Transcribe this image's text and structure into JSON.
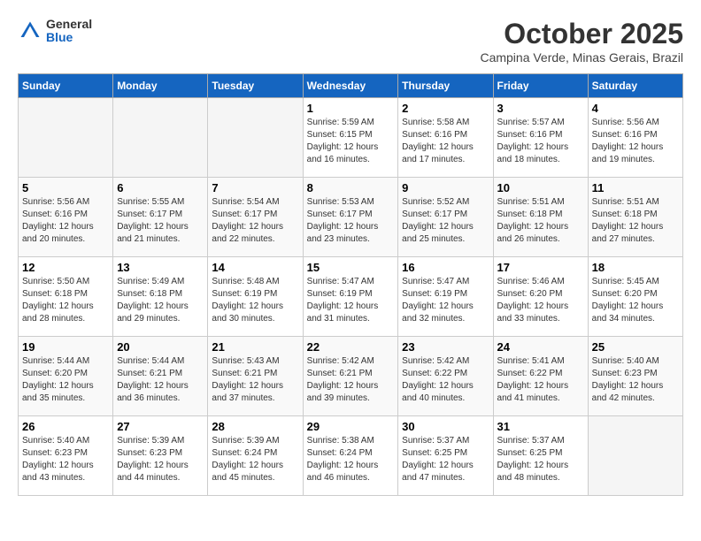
{
  "header": {
    "logo_general": "General",
    "logo_blue": "Blue",
    "month_title": "October 2025",
    "location": "Campina Verde, Minas Gerais, Brazil"
  },
  "weekdays": [
    "Sunday",
    "Monday",
    "Tuesday",
    "Wednesday",
    "Thursday",
    "Friday",
    "Saturday"
  ],
  "weeks": [
    [
      {
        "day": "",
        "info": ""
      },
      {
        "day": "",
        "info": ""
      },
      {
        "day": "",
        "info": ""
      },
      {
        "day": "1",
        "info": "Sunrise: 5:59 AM\nSunset: 6:15 PM\nDaylight: 12 hours\nand 16 minutes."
      },
      {
        "day": "2",
        "info": "Sunrise: 5:58 AM\nSunset: 6:16 PM\nDaylight: 12 hours\nand 17 minutes."
      },
      {
        "day": "3",
        "info": "Sunrise: 5:57 AM\nSunset: 6:16 PM\nDaylight: 12 hours\nand 18 minutes."
      },
      {
        "day": "4",
        "info": "Sunrise: 5:56 AM\nSunset: 6:16 PM\nDaylight: 12 hours\nand 19 minutes."
      }
    ],
    [
      {
        "day": "5",
        "info": "Sunrise: 5:56 AM\nSunset: 6:16 PM\nDaylight: 12 hours\nand 20 minutes."
      },
      {
        "day": "6",
        "info": "Sunrise: 5:55 AM\nSunset: 6:17 PM\nDaylight: 12 hours\nand 21 minutes."
      },
      {
        "day": "7",
        "info": "Sunrise: 5:54 AM\nSunset: 6:17 PM\nDaylight: 12 hours\nand 22 minutes."
      },
      {
        "day": "8",
        "info": "Sunrise: 5:53 AM\nSunset: 6:17 PM\nDaylight: 12 hours\nand 23 minutes."
      },
      {
        "day": "9",
        "info": "Sunrise: 5:52 AM\nSunset: 6:17 PM\nDaylight: 12 hours\nand 25 minutes."
      },
      {
        "day": "10",
        "info": "Sunrise: 5:51 AM\nSunset: 6:18 PM\nDaylight: 12 hours\nand 26 minutes."
      },
      {
        "day": "11",
        "info": "Sunrise: 5:51 AM\nSunset: 6:18 PM\nDaylight: 12 hours\nand 27 minutes."
      }
    ],
    [
      {
        "day": "12",
        "info": "Sunrise: 5:50 AM\nSunset: 6:18 PM\nDaylight: 12 hours\nand 28 minutes."
      },
      {
        "day": "13",
        "info": "Sunrise: 5:49 AM\nSunset: 6:18 PM\nDaylight: 12 hours\nand 29 minutes."
      },
      {
        "day": "14",
        "info": "Sunrise: 5:48 AM\nSunset: 6:19 PM\nDaylight: 12 hours\nand 30 minutes."
      },
      {
        "day": "15",
        "info": "Sunrise: 5:47 AM\nSunset: 6:19 PM\nDaylight: 12 hours\nand 31 minutes."
      },
      {
        "day": "16",
        "info": "Sunrise: 5:47 AM\nSunset: 6:19 PM\nDaylight: 12 hours\nand 32 minutes."
      },
      {
        "day": "17",
        "info": "Sunrise: 5:46 AM\nSunset: 6:20 PM\nDaylight: 12 hours\nand 33 minutes."
      },
      {
        "day": "18",
        "info": "Sunrise: 5:45 AM\nSunset: 6:20 PM\nDaylight: 12 hours\nand 34 minutes."
      }
    ],
    [
      {
        "day": "19",
        "info": "Sunrise: 5:44 AM\nSunset: 6:20 PM\nDaylight: 12 hours\nand 35 minutes."
      },
      {
        "day": "20",
        "info": "Sunrise: 5:44 AM\nSunset: 6:21 PM\nDaylight: 12 hours\nand 36 minutes."
      },
      {
        "day": "21",
        "info": "Sunrise: 5:43 AM\nSunset: 6:21 PM\nDaylight: 12 hours\nand 37 minutes."
      },
      {
        "day": "22",
        "info": "Sunrise: 5:42 AM\nSunset: 6:21 PM\nDaylight: 12 hours\nand 39 minutes."
      },
      {
        "day": "23",
        "info": "Sunrise: 5:42 AM\nSunset: 6:22 PM\nDaylight: 12 hours\nand 40 minutes."
      },
      {
        "day": "24",
        "info": "Sunrise: 5:41 AM\nSunset: 6:22 PM\nDaylight: 12 hours\nand 41 minutes."
      },
      {
        "day": "25",
        "info": "Sunrise: 5:40 AM\nSunset: 6:23 PM\nDaylight: 12 hours\nand 42 minutes."
      }
    ],
    [
      {
        "day": "26",
        "info": "Sunrise: 5:40 AM\nSunset: 6:23 PM\nDaylight: 12 hours\nand 43 minutes."
      },
      {
        "day": "27",
        "info": "Sunrise: 5:39 AM\nSunset: 6:23 PM\nDaylight: 12 hours\nand 44 minutes."
      },
      {
        "day": "28",
        "info": "Sunrise: 5:39 AM\nSunset: 6:24 PM\nDaylight: 12 hours\nand 45 minutes."
      },
      {
        "day": "29",
        "info": "Sunrise: 5:38 AM\nSunset: 6:24 PM\nDaylight: 12 hours\nand 46 minutes."
      },
      {
        "day": "30",
        "info": "Sunrise: 5:37 AM\nSunset: 6:25 PM\nDaylight: 12 hours\nand 47 minutes."
      },
      {
        "day": "31",
        "info": "Sunrise: 5:37 AM\nSunset: 6:25 PM\nDaylight: 12 hours\nand 48 minutes."
      },
      {
        "day": "",
        "info": ""
      }
    ]
  ]
}
